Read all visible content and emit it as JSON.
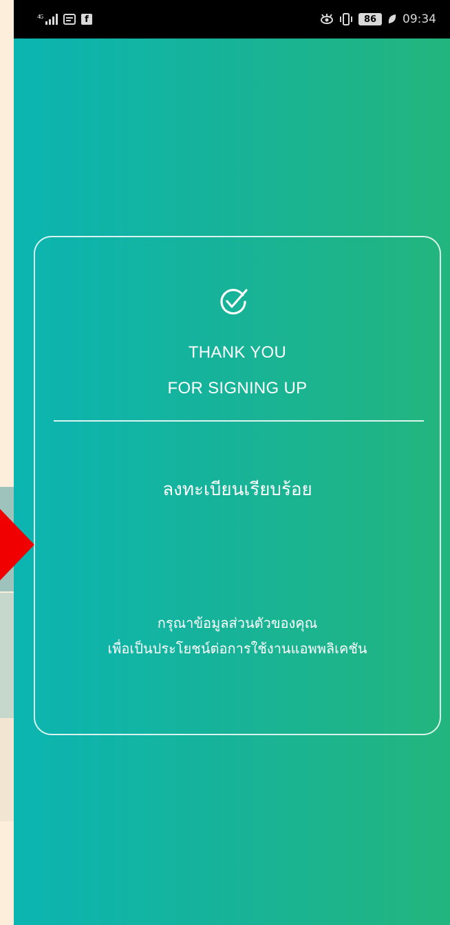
{
  "status_bar": {
    "signal_label": "4G",
    "fb_label": "f",
    "battery_level": "86",
    "time": "09:34",
    "icons": [
      "signal-icon",
      "message-icon",
      "facebook-icon",
      "eye-icon",
      "vibrate-icon",
      "battery-icon",
      "leaf-icon"
    ]
  },
  "card": {
    "icon": "check-circle-icon",
    "title_line_1": "THANK YOU",
    "title_line_2": "FOR SIGNING UP",
    "thai_title": "ลงทะเบียนเรียบร้อย",
    "message_line_1": "กรุณาข้อมูลส่วนตัวของคุณ",
    "message_line_2": "เพื่อเป็นประโยชน์ต่อการใช้งานแอพพลิเคชัน"
  },
  "colors": {
    "gradient_start": "#0bb5b1",
    "gradient_end": "#23b57e",
    "annotation_arrow": "#f00000",
    "slide_background": "#fdeedb"
  }
}
